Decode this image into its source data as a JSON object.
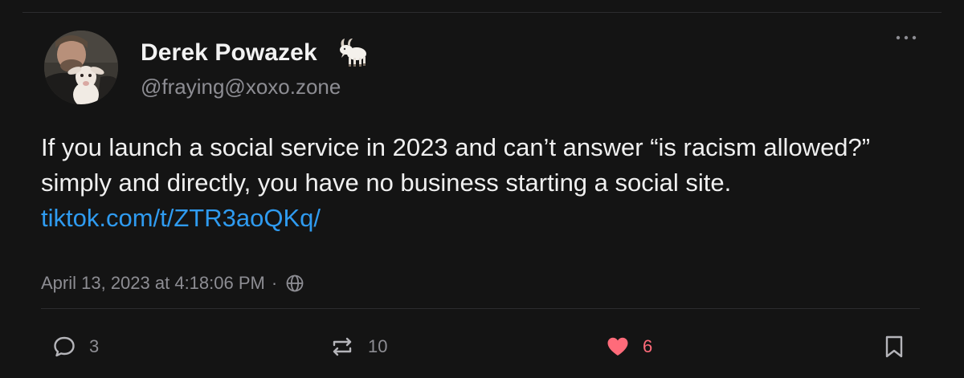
{
  "author": {
    "display_name": "Derek Powazek",
    "emoji": "goat",
    "handle": "@fraying@xoxo.zone",
    "avatar_icon": "avatar-man-holding-baby-goat"
  },
  "post": {
    "text": "If you launch a social service in 2023 and can’t answer “is racism allowed?” simply and directly, you have no business starting a social site. ",
    "link_text": "tiktok.com/t/ZTR3aoQKq/",
    "timestamp": "April 13, 2023 at 4:18:06 PM",
    "separator": "·",
    "visibility_icon": "globe-icon"
  },
  "actions": {
    "replies": {
      "icon": "reply-icon",
      "count": "3"
    },
    "boosts": {
      "icon": "boost-icon",
      "count": "10"
    },
    "likes": {
      "icon": "heart-icon",
      "count": "6",
      "liked": true
    },
    "bookmark": {
      "icon": "bookmark-icon"
    }
  },
  "menu": {
    "icon": "more-icon"
  },
  "colors": {
    "background": "#141414",
    "text": "#f0f0f0",
    "muted": "#8d8d93",
    "link": "#2f9bf0",
    "like": "#ff6b7a"
  }
}
